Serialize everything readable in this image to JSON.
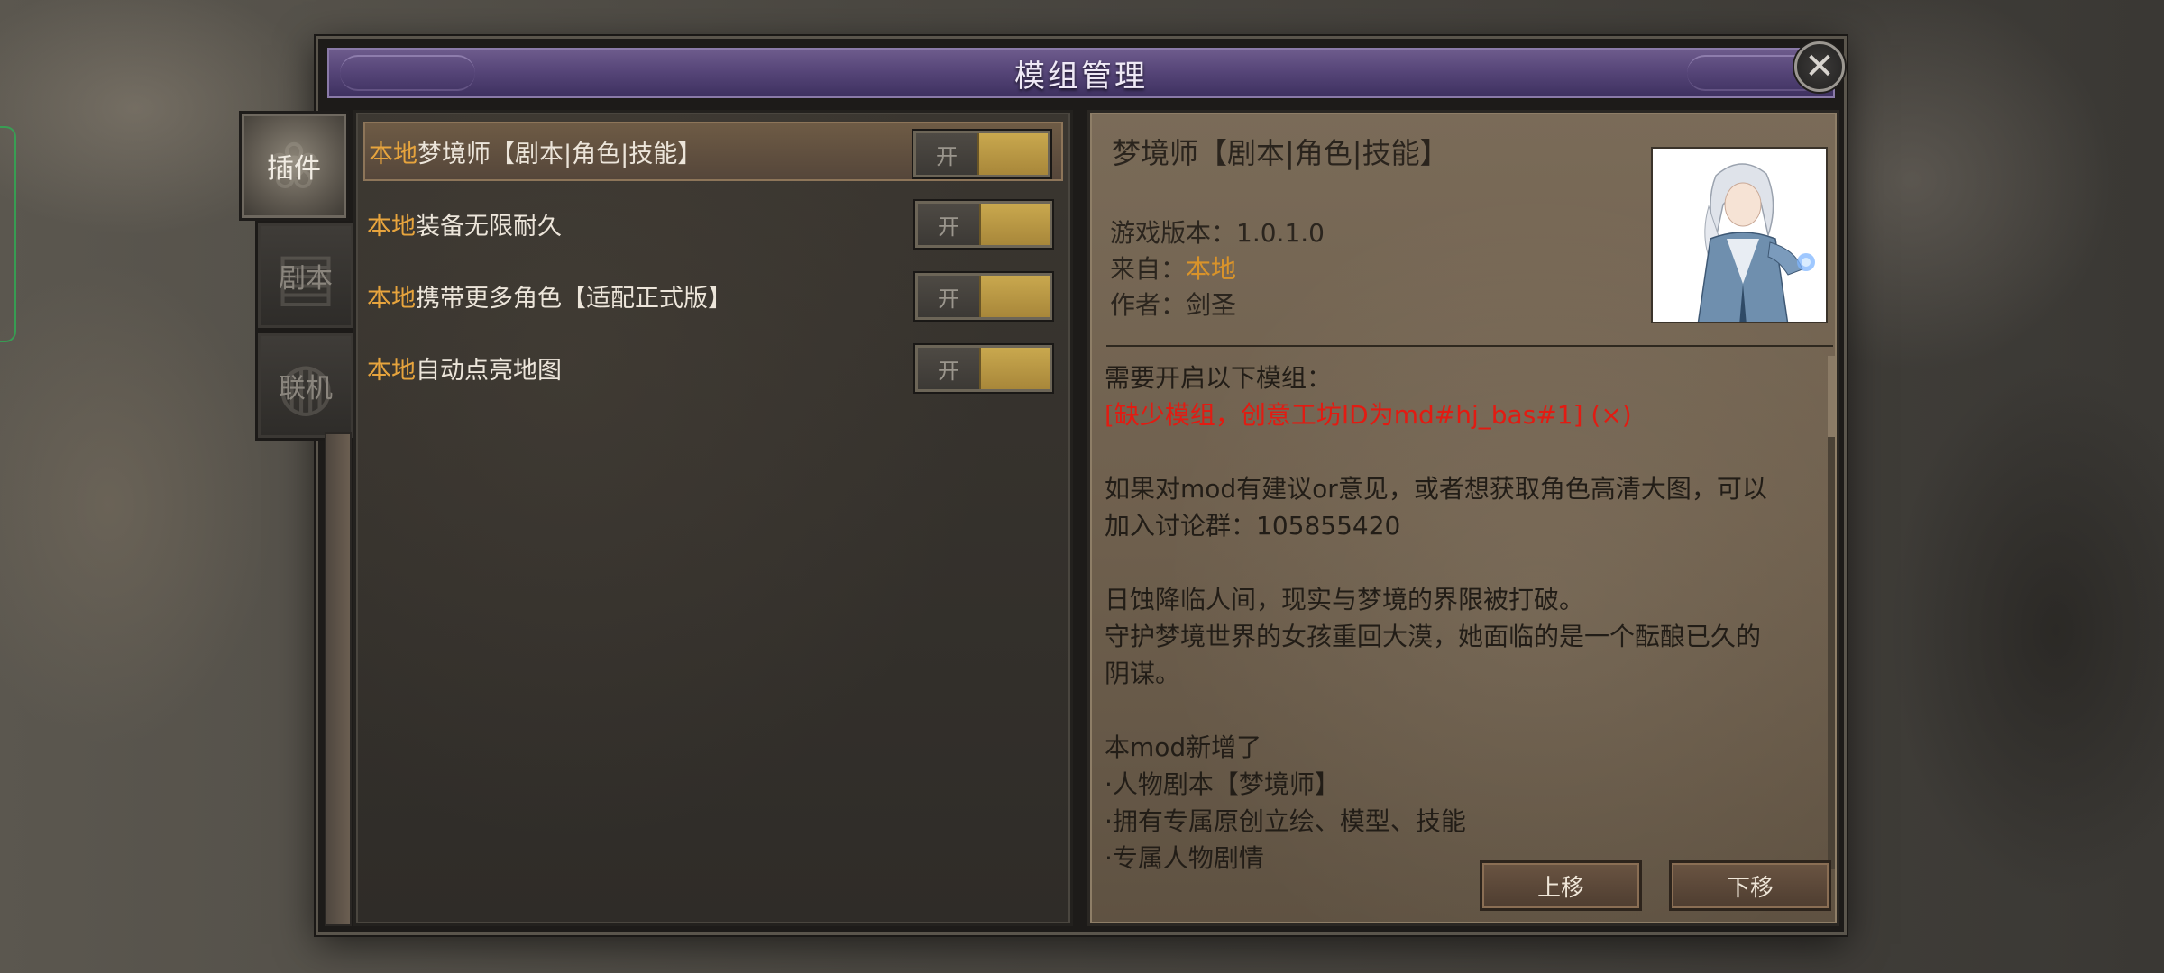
{
  "window": {
    "title": "模组管理",
    "close_glyph": "✕"
  },
  "side_tabs": [
    {
      "label": "插件",
      "active": true
    },
    {
      "label": "剧本",
      "active": false
    },
    {
      "label": "联机",
      "active": false
    }
  ],
  "mod_list": [
    {
      "source": "本地",
      "name": "梦境师【剧本|角色|技能】",
      "toggle": "开",
      "selected": true
    },
    {
      "source": "本地",
      "name": "装备无限耐久",
      "toggle": "开",
      "selected": false
    },
    {
      "source": "本地",
      "name": "携带更多角色【适配正式版】",
      "toggle": "开",
      "selected": false
    },
    {
      "source": "本地",
      "name": "自动点亮地图",
      "toggle": "开",
      "selected": false
    }
  ],
  "detail": {
    "title": "梦境师【剧本|角色|技能】",
    "version_label": "游戏版本：",
    "version_value": "1.0.1.0",
    "from_label": "来自：",
    "from_value": "本地",
    "author_label": "作者：",
    "author_value": "剑圣",
    "requires_label": "需要开启以下模组：",
    "missing_mod": "[缺少模组，创意工坊ID为md#hj_bas#1] (×)",
    "para1_line1": "如果对mod有建议or意见，或者想获取角色高清大图，可以",
    "para1_line2": "加入讨论群：105855420",
    "para2_line1": "日蚀降临人间，现实与梦境的界限被打破。",
    "para2_line2": "守护梦境世界的女孩重回大漠，她面临的是一个酝酿已久的",
    "para2_line3": "阴谋。",
    "para3_line1": "本mod新增了",
    "para3_line2": "·人物剧本【梦境师】",
    "para3_line3": "·拥有专属原创立绘、模型、技能",
    "para3_line4": "·专属人物剧情"
  },
  "buttons": {
    "move_up": "上移",
    "move_down": "下移"
  },
  "colors": {
    "title_bar": "#574679",
    "source_orange": "#e7a43d",
    "missing_red": "#e21b12",
    "toggle_gold": "#c9a84e"
  }
}
